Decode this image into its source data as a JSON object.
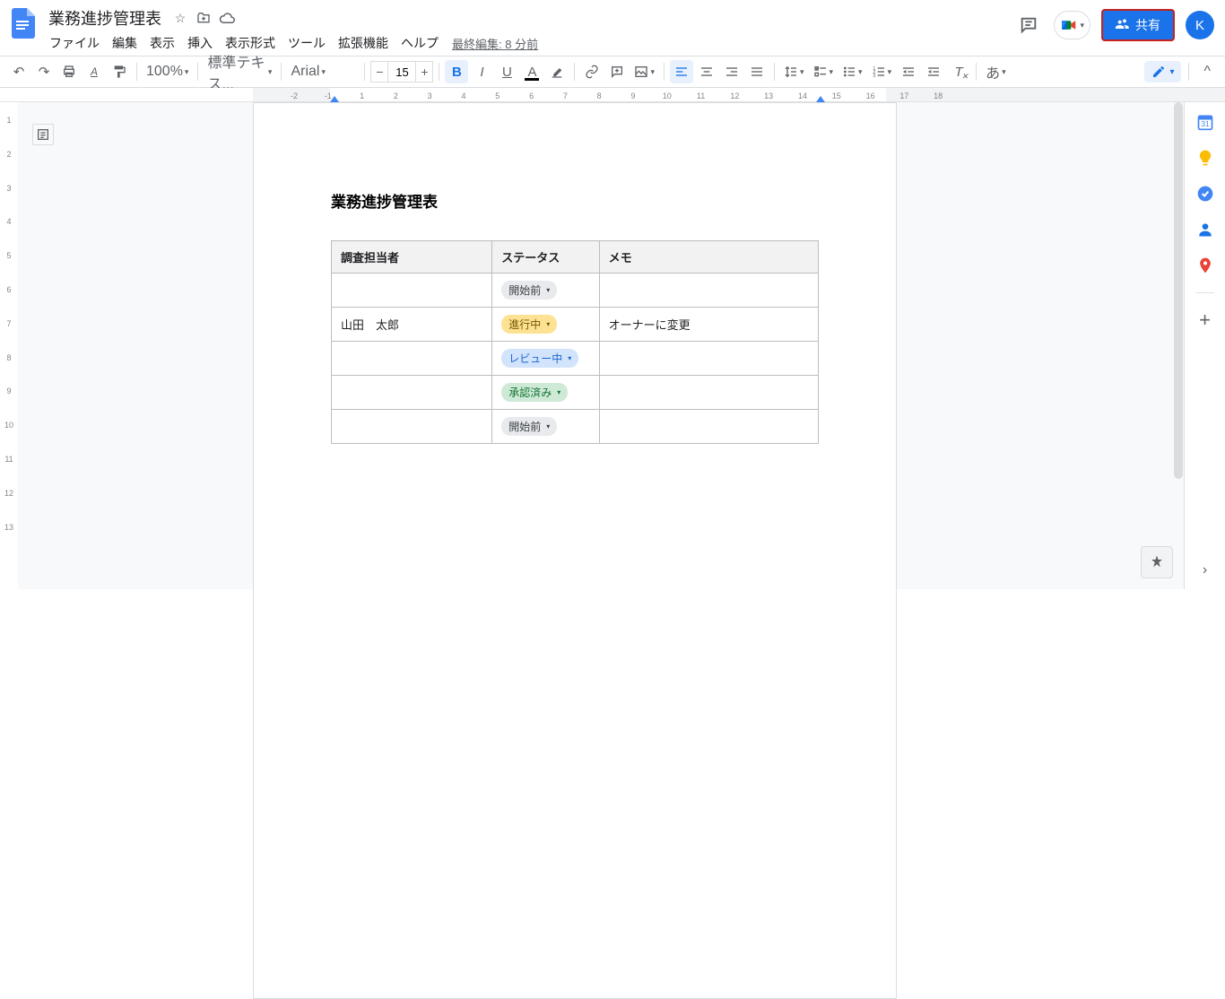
{
  "header": {
    "title": "業務進捗管理表",
    "last_edit": "最終編集: 8 分前",
    "menus": [
      "ファイル",
      "編集",
      "表示",
      "挿入",
      "表示形式",
      "ツール",
      "拡張機能",
      "ヘルプ"
    ],
    "share": "共有",
    "avatar": "K"
  },
  "toolbar": {
    "zoom": "100%",
    "styles": "標準テキス...",
    "font": "Arial",
    "size": "15",
    "ime": "あ"
  },
  "ruler": [
    "-2",
    "-1",
    "1",
    "2",
    "3",
    "4",
    "5",
    "6",
    "7",
    "8",
    "9",
    "10",
    "11",
    "12",
    "13",
    "14",
    "15",
    "16",
    "17",
    "18"
  ],
  "vruler": [
    "1",
    "2",
    "3",
    "4",
    "5",
    "6",
    "7",
    "8",
    "9",
    "10",
    "11",
    "12",
    "13"
  ],
  "doc": {
    "heading": "業務進捗管理表",
    "th": [
      "調査担当者",
      "ステータス",
      "メモ"
    ],
    "rows": [
      {
        "a": "",
        "s": "開始前",
        "c": "chip-grey",
        "m": ""
      },
      {
        "a": "山田　太郎",
        "s": "進行中",
        "c": "chip-orange",
        "m": "オーナーに変更"
      },
      {
        "a": "",
        "s": "レビュー中",
        "c": "chip-blue",
        "m": ""
      },
      {
        "a": "",
        "s": "承認済み",
        "c": "chip-green",
        "m": ""
      },
      {
        "a": "",
        "s": "開始前",
        "c": "chip-grey",
        "m": ""
      }
    ]
  }
}
